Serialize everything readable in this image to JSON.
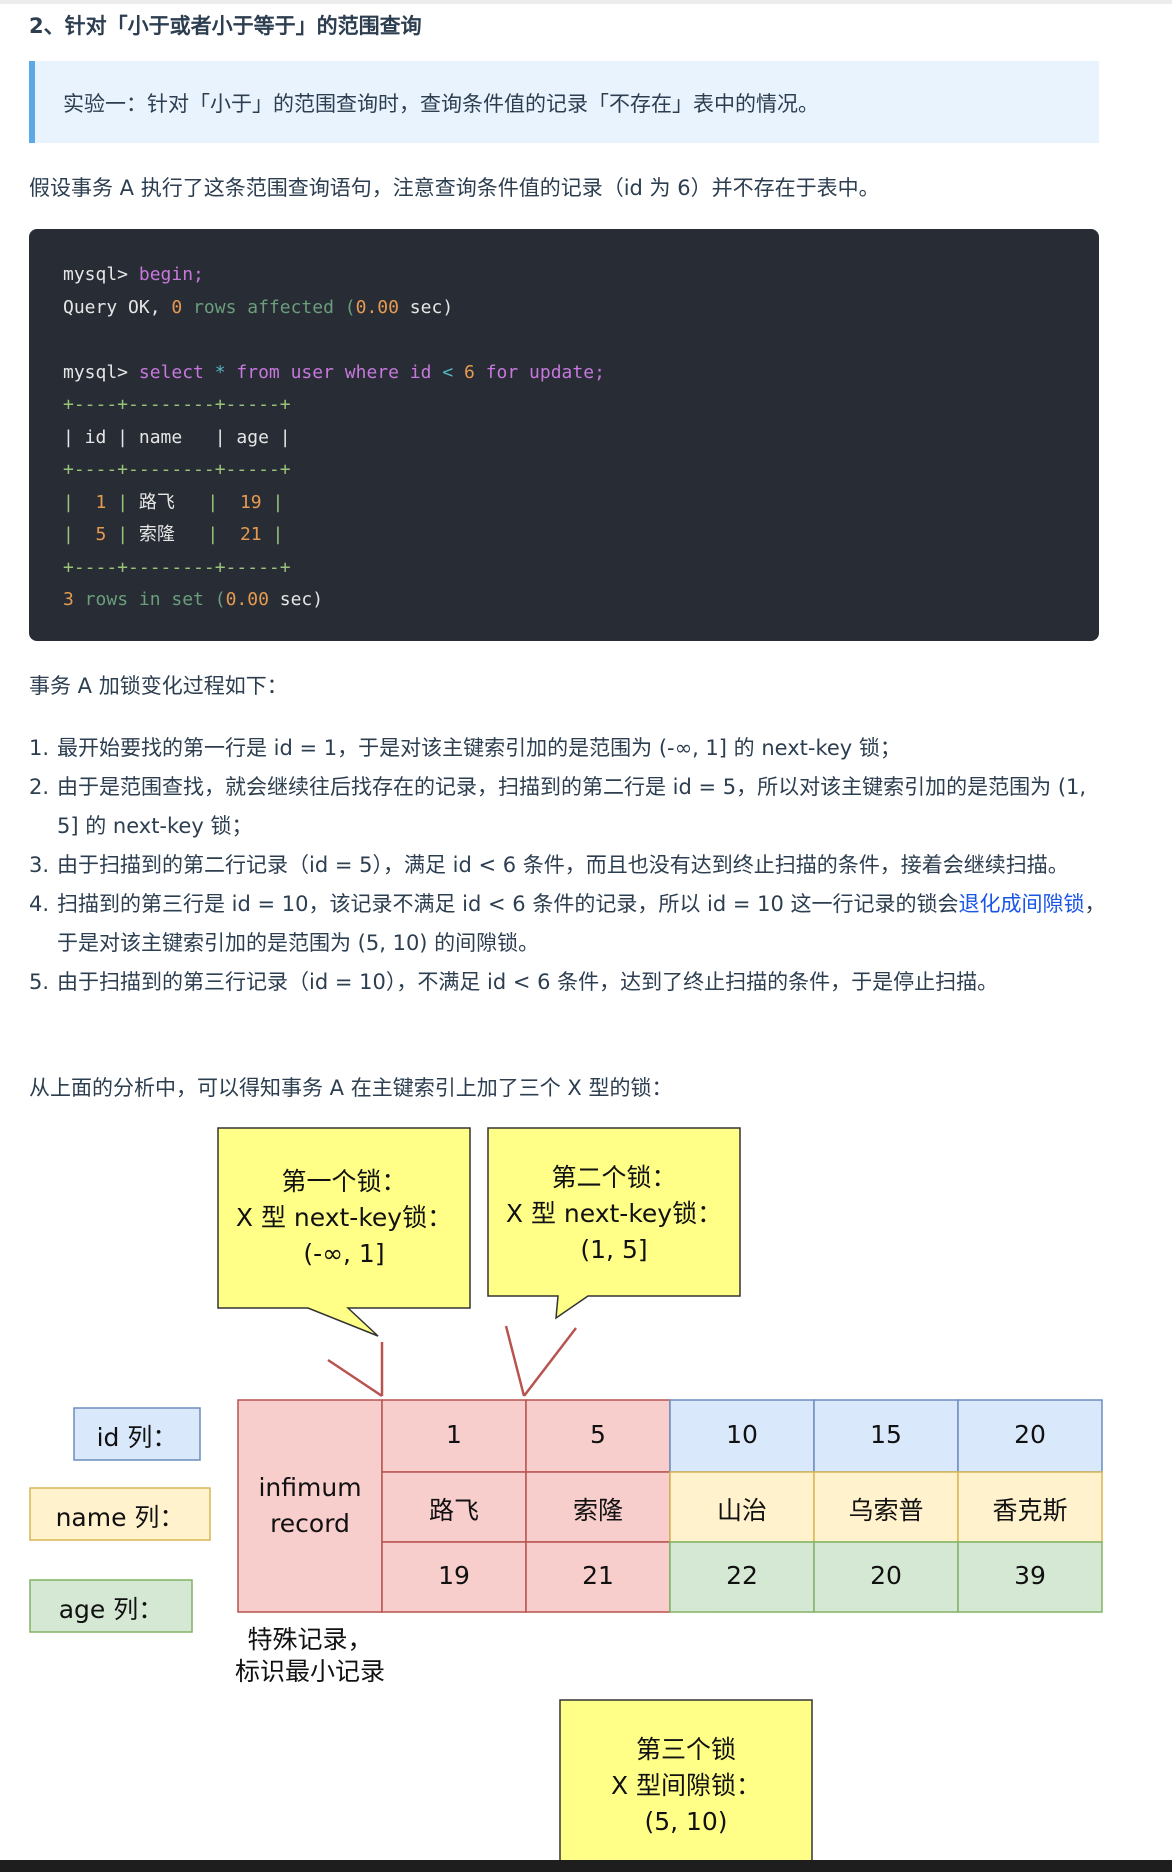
{
  "heading": "2、针对「小于或者小于等于」的范围查询",
  "callout": "实验一：针对「小于」的范围查询时，查询条件值的记录「不存在」表中的情况。",
  "intro": "假设事务 A 执行了这条范围查询语句，注意查询条件值的记录（id 为 6）并不存在于表中。",
  "code": {
    "prompt": "mysql>",
    "cmd1": "begin;",
    "result1_a": "Query OK, ",
    "result1_n": "0",
    "result1_b": " rows affected (",
    "result1_t": "0.00",
    "result1_c": " sec)",
    "cmd2_a": "select ",
    "cmd2_star": "*",
    "cmd2_b": " from user where id ",
    "cmd2_lt": "<",
    "cmd2_n": "6",
    "cmd2_c": " for update;",
    "border": "+----+--------+-----+",
    "header": "| id | name   | age |",
    "rows": [
      {
        "id": "1",
        "name": "路飞",
        "age": "19"
      },
      {
        "id": "5",
        "name": "索隆",
        "age": "21"
      }
    ],
    "footer_n": "3",
    "footer_a": " rows in set (",
    "footer_t": "0.00",
    "footer_b": " sec)"
  },
  "process_title": "事务 A 加锁变化过程如下：",
  "steps": [
    {
      "num": "1.",
      "text": "最开始要找的第一行是 id = 1，于是对该主键索引加的是范围为 (-∞, 1] 的 next-key 锁；"
    },
    {
      "num": "2.",
      "text": "由于是范围查找，就会继续往后找存在的记录，扫描到的第二行是 id = 5，所以对该主键索引加的是范围为 (1, 5] 的 next-key 锁；"
    },
    {
      "num": "3.",
      "text": "由于扫描到的第二行记录（id = 5），满足 id < 6 条件，而且也没有达到终止扫描的条件，接着会继续扫描。"
    },
    {
      "num": "4.",
      "text_a": "扫描到的第三行是 id = 10，该记录不满足 id < 6 条件的记录，所以 id = 10 这一行记录的锁会",
      "link": "退化成间隙锁",
      "text_b": "，于是对该主键索引加的是范围为 (5, 10) 的间隙锁。"
    },
    {
      "num": "5.",
      "text": "由于扫描到的第三行记录（id = 10），不满足 id < 6 条件，达到了终止扫描的条件，于是停止扫描。"
    }
  ],
  "summary": "从上面的分析中，可以得知事务 A 在主键索引上加了三个 X 型的锁：",
  "diagram": {
    "lock1": {
      "l1": "第一个锁：",
      "l2": "X 型 next-key锁：",
      "l3": "(-∞, 1]"
    },
    "lock2": {
      "l1": "第二个锁：",
      "l2": "X 型 next-key锁：",
      "l3": "(1, 5]"
    },
    "lock3": {
      "l1": "第三个锁",
      "l2": "X 型间隙锁：",
      "l3": "(5, 10)"
    },
    "col_id": "id 列：",
    "col_name": "name 列：",
    "col_age": "age 列：",
    "infimum": {
      "l1": "infimum",
      "l2": "record"
    },
    "infimum_note": {
      "l1": "特殊记录，",
      "l2": "标识最小记录"
    },
    "records": [
      {
        "id": "1",
        "name": "路飞",
        "age": "19"
      },
      {
        "id": "5",
        "name": "索隆",
        "age": "21"
      },
      {
        "id": "10",
        "name": "山治",
        "age": "22"
      },
      {
        "id": "15",
        "name": "乌索普",
        "age": "20"
      },
      {
        "id": "20",
        "name": "香克斯",
        "age": "39"
      }
    ],
    "colors": {
      "locked": "#f8cecc",
      "locked_border": "#b85450",
      "id_bg": "#dae8fc",
      "name_bg": "#fff2cc",
      "age_bg": "#d5e8d4",
      "callout_bg": "#ffff88"
    }
  }
}
